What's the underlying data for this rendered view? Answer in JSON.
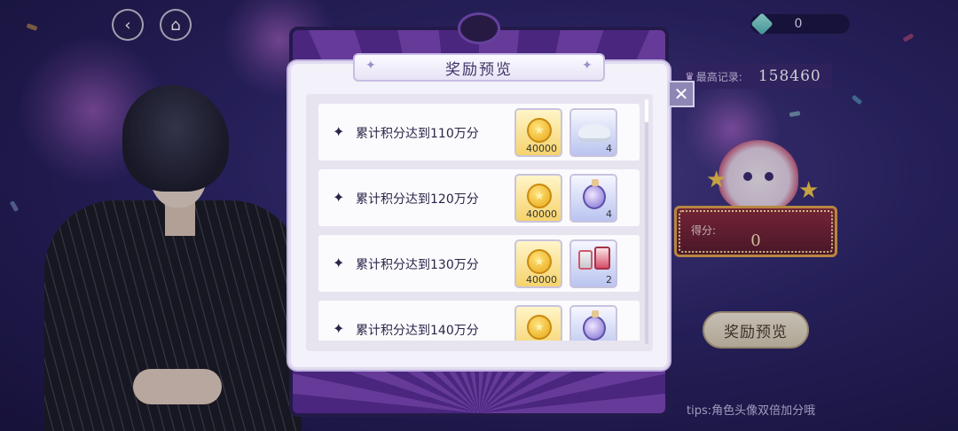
{
  "top_left": {
    "back_icon": "back-arrow-icon",
    "home_icon": "castle-icon"
  },
  "currency": {
    "icon": "gem-icon",
    "value": "0"
  },
  "record": {
    "label": "最高记录:",
    "value": "158460"
  },
  "score": {
    "label": "得分:",
    "value": "0"
  },
  "preview_button": {
    "label": "奖励预览"
  },
  "tips": "tips:角色头像双倍加分哦",
  "modal": {
    "title": "奖励预览",
    "close_icon": "close-icon",
    "rows": [
      {
        "label": "累计积分达到110万分",
        "items": [
          {
            "icon": "coin-icon",
            "qty": "40000"
          },
          {
            "icon": "powder-icon",
            "qty": "4"
          }
        ]
      },
      {
        "label": "累计积分达到120万分",
        "items": [
          {
            "icon": "coin-icon",
            "qty": "40000"
          },
          {
            "icon": "potion-icon",
            "qty": "4"
          }
        ]
      },
      {
        "label": "累计积分达到130万分",
        "items": [
          {
            "icon": "coin-icon",
            "qty": "40000"
          },
          {
            "icon": "cans-icon",
            "qty": "2"
          }
        ]
      },
      {
        "label": "累计积分达到140万分",
        "items": [
          {
            "icon": "coin-icon",
            "qty": ""
          },
          {
            "icon": "potion-icon",
            "qty": ""
          }
        ]
      }
    ]
  },
  "colors": {
    "accent": "#3d3366",
    "gold": "#f6d36b",
    "panel": "#f3f1f9"
  }
}
